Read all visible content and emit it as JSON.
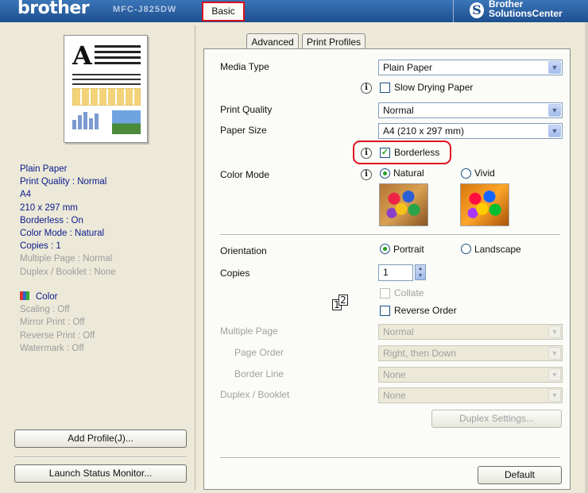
{
  "header": {
    "brand": "brother",
    "model": "MFC-J825DW",
    "solutions_line1": "Brother",
    "solutions_line2": "SolutionsCenter"
  },
  "summary": {
    "media": "Plain Paper",
    "quality": "Print Quality : Normal",
    "size1": "A4",
    "size2": "210 x 297 mm",
    "borderless": "Borderless : On",
    "color_mode": "Color Mode : Natural",
    "copies": "Copies : 1",
    "multiple_page": "Multiple Page : Normal",
    "duplex": "Duplex / Booklet : None",
    "color": "Color",
    "scaling": "Scaling : Off",
    "mirror": "Mirror Print : Off",
    "reverse": "Reverse Print : Off",
    "watermark": "Watermark : Off"
  },
  "left_buttons": {
    "add_profile": "Add Profile(J)...",
    "status_monitor": "Launch Status Monitor..."
  },
  "tabs": {
    "basic": "Basic",
    "advanced": "Advanced",
    "profiles": "Print Profiles"
  },
  "form": {
    "media_type_label": "Media Type",
    "media_type_value": "Plain Paper",
    "slow_drying": "Slow Drying Paper",
    "print_quality_label": "Print Quality",
    "print_quality_value": "Normal",
    "paper_size_label": "Paper Size",
    "paper_size_value": "A4 (210 x 297 mm)",
    "borderless": "Borderless",
    "color_mode_label": "Color Mode",
    "natural": "Natural",
    "vivid": "Vivid",
    "orientation_label": "Orientation",
    "portrait": "Portrait",
    "landscape": "Landscape",
    "copies_label": "Copies",
    "copies_value": "1",
    "collate": "Collate",
    "reverse_order": "Reverse Order",
    "multiple_page_label": "Multiple Page",
    "multiple_page_value": "Normal",
    "page_order_label": "Page Order",
    "page_order_value": "Right, then Down",
    "border_line_label": "Border Line",
    "border_line_value": "None",
    "duplex_label": "Duplex / Booklet",
    "duplex_value": "None",
    "duplex_settings": "Duplex Settings...",
    "default": "Default"
  },
  "icons": {
    "info": "info-icon",
    "dropdown": "chevron-down-icon",
    "copies": "collate-pages-icon"
  },
  "colors": {
    "highlight": "#e0101c",
    "banner": "#1d4f8f",
    "summary_text": "#0a1a8c",
    "disabled_text": "#9c9c9c"
  }
}
